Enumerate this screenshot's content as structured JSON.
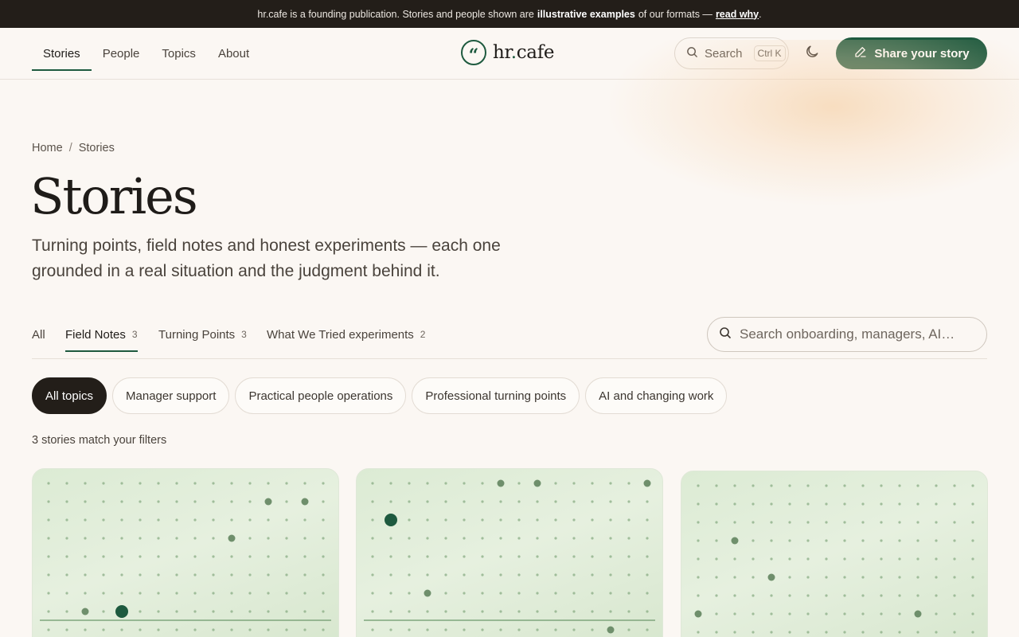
{
  "announcement": {
    "text_before": "hr.cafe is a founding publication. Stories and people shown are",
    "bold": "illustrative examples",
    "text_after": "of our formats —",
    "link": "read why",
    "end": "."
  },
  "nav": {
    "items": [
      {
        "label": "Stories",
        "active": true
      },
      {
        "label": "People",
        "active": false
      },
      {
        "label": "Topics",
        "active": false
      },
      {
        "label": "About",
        "active": false
      }
    ]
  },
  "logo": {
    "mark": "“",
    "name": "hr",
    "dot": ".",
    "suffix": "cafe"
  },
  "header": {
    "search_label": "Search",
    "search_shortcut": "Ctrl K",
    "share_label": "Share your story",
    "colors": {
      "accent": "#1e5a3f",
      "dark": "#231e19"
    }
  },
  "breadcrumb": {
    "home": "Home",
    "separator": "/",
    "current": "Stories"
  },
  "page": {
    "title": "Stories",
    "subtitle": "Turning points, field notes and honest experiments — each one grounded in a real situation and the judgment behind it."
  },
  "tabs": [
    {
      "label": "All",
      "count": "",
      "active": false
    },
    {
      "label": "Field Notes",
      "count": "3",
      "active": true
    },
    {
      "label": "Turning Points",
      "count": "3",
      "active": false
    },
    {
      "label": "What We Tried experiments",
      "count": "2",
      "active": false
    }
  ],
  "story_search": {
    "placeholder": "Search onboarding, managers, AI…",
    "value": ""
  },
  "chips": [
    {
      "label": "All topics",
      "active": true
    },
    {
      "label": "Manager support",
      "active": false
    },
    {
      "label": "Practical people operations",
      "active": false
    },
    {
      "label": "Professional turning points",
      "active": false
    },
    {
      "label": "AI and changing work",
      "active": false
    }
  ],
  "results": {
    "summary": "3 stories match your filters"
  },
  "icons": {
    "search": "search-icon",
    "theme": "moon-icon",
    "share": "pencil-icon",
    "logo": "quote-icon"
  }
}
